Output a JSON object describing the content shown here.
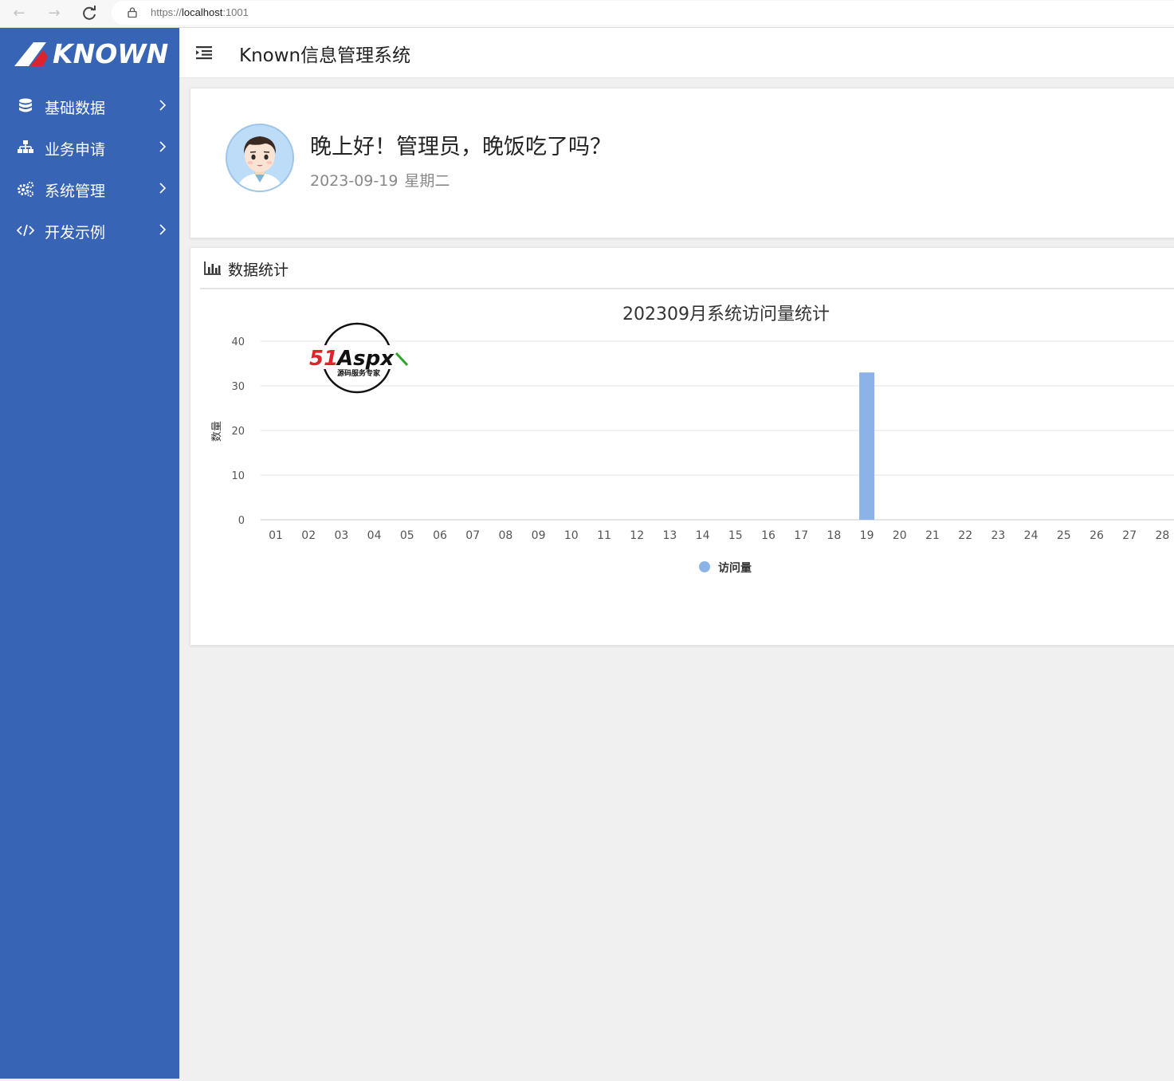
{
  "browser": {
    "url_scheme": "https://",
    "url_host": "localhost",
    "url_port": ":1001"
  },
  "sidebar": {
    "logo_text": "KNOWN",
    "items": [
      {
        "label": "基础数据",
        "icon": "database-icon"
      },
      {
        "label": "业务申请",
        "icon": "sitemap-icon"
      },
      {
        "label": "系统管理",
        "icon": "gears-icon"
      },
      {
        "label": "开发示例",
        "icon": "code-icon"
      }
    ]
  },
  "header": {
    "title": "Known信息管理系统"
  },
  "welcome": {
    "greeting": "晚上好！管理员，晚饭吃了吗？",
    "date": "2023-09-19",
    "weekday": "星期二"
  },
  "stats": {
    "title": "数据统计"
  },
  "watermark": {
    "brand": "51Aspx",
    "tagline": "源码服务专家"
  },
  "colors": {
    "sidebar": "#3864b5",
    "bar": "#8cb3e8",
    "accent_red": "#e0232b",
    "accent_green": "#2ca62a"
  },
  "chart_data": {
    "type": "bar",
    "title": "202309月系统访问量统计",
    "ylabel": "数量",
    "xlabel": "",
    "ylim": [
      0,
      40
    ],
    "yticks": [
      0,
      10,
      20,
      30,
      40
    ],
    "grid": true,
    "legend_position": "bottom",
    "categories": [
      "01",
      "02",
      "03",
      "04",
      "05",
      "06",
      "07",
      "08",
      "09",
      "10",
      "11",
      "12",
      "13",
      "14",
      "15",
      "16",
      "17",
      "18",
      "19",
      "20",
      "21",
      "22",
      "23",
      "24",
      "25",
      "26",
      "27",
      "28"
    ],
    "series": [
      {
        "name": "访问量",
        "values": [
          0,
          0,
          0,
          0,
          0,
          0,
          0,
          0,
          0,
          0,
          0,
          0,
          0,
          0,
          0,
          0,
          0,
          0,
          33,
          0,
          0,
          0,
          0,
          0,
          0,
          0,
          0,
          0
        ]
      }
    ]
  }
}
